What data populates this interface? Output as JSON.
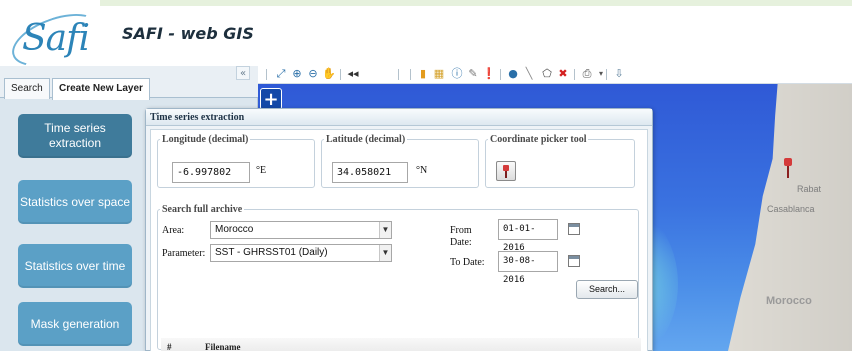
{
  "header": {
    "logo_text": "Safi",
    "app_title": "SAFI - web GIS"
  },
  "left_panel": {
    "tabs": [
      {
        "label": "Search"
      },
      {
        "label": "Create New Layer"
      }
    ],
    "collapse_glyph": "«",
    "buttons": [
      {
        "label": "Time series extraction"
      },
      {
        "label": "Statistics over space"
      },
      {
        "label": "Statistics over time"
      },
      {
        "label": "Mask generation"
      }
    ]
  },
  "toolbar": {
    "icons": [
      "zoom-extent-icon",
      "zoom-in-icon",
      "zoom-out-icon",
      "pan-hand-icon",
      "previous-view-icon",
      "layers-icon",
      "info-icon",
      "measure-icon",
      "pin-icon",
      "point-icon",
      "line-icon",
      "polygon-icon",
      "delete-icon",
      "print-icon",
      "export-icon"
    ]
  },
  "map": {
    "zoom_plus": "+",
    "labels": {
      "rabat": "Rabat",
      "casablanca": "Casablanca",
      "morocco": "Morocco"
    },
    "colors": {
      "sea_deep": "#2f59d6",
      "sea_shallow": "#63a6ef",
      "land": "#dedbd4"
    }
  },
  "window": {
    "title": "Time series extraction",
    "longitude": {
      "legend": "Longitude (decimal)",
      "value": "-6.997802",
      "unit": "°E"
    },
    "latitude": {
      "legend": "Latitude (decimal)",
      "value": "34.058021",
      "unit": "°N"
    },
    "picker": {
      "legend": "Coordinate picker tool"
    },
    "archive": {
      "legend": "Search full archive",
      "area_label": "Area:",
      "area_value": "Morocco",
      "parameter_label": "Parameter:",
      "parameter_value": "SST - GHRSST01 (Daily)",
      "from_label": "From Date:",
      "from_value": "01-01-2016",
      "to_label": "To Date:",
      "to_value": "30-08-2016",
      "search_button": "Search..."
    },
    "results": {
      "col_index": "#",
      "col_filename": "Filename"
    }
  }
}
